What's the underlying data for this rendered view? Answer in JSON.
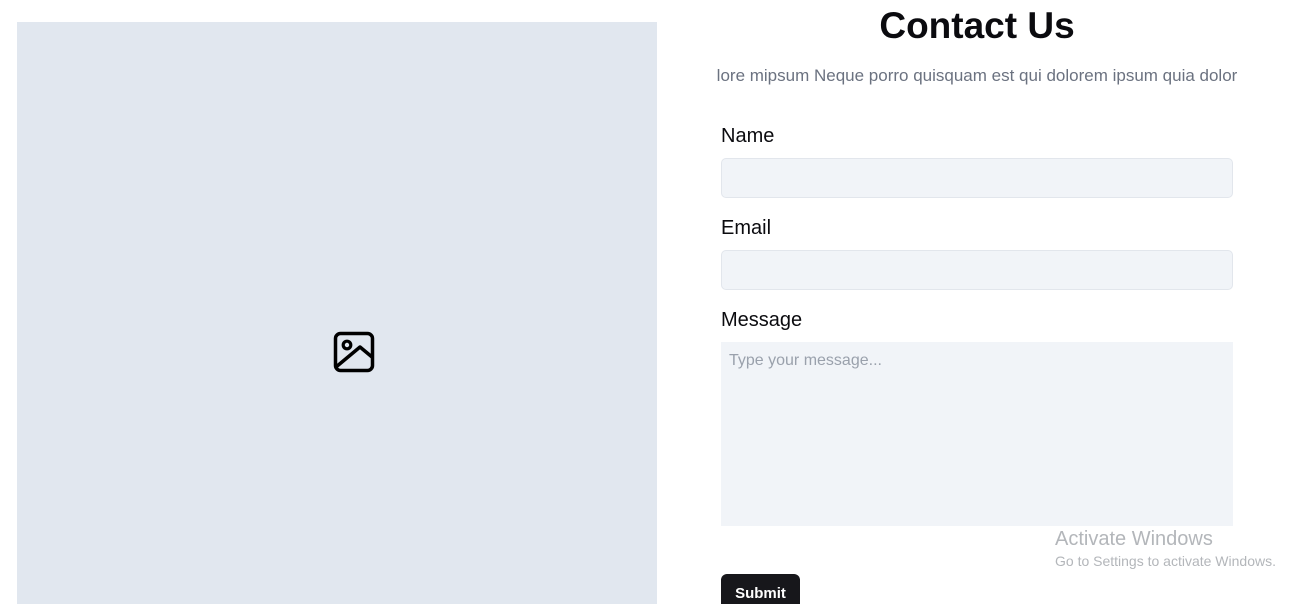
{
  "image_placeholder": {
    "icon": "image-icon",
    "background": "#e1e7ef"
  },
  "header": {
    "title": "Contact Us",
    "subtitle": "lore mipsum Neque porro quisquam est qui dolorem ipsum quia dolor"
  },
  "form": {
    "name_label": "Name",
    "name_value": "",
    "email_label": "Email",
    "email_value": "",
    "message_label": "Message",
    "message_placeholder": "Type your message...",
    "submit_label": "Submit"
  },
  "watermark": {
    "title": "Activate Windows",
    "subtitle": "Go to Settings to activate Windows."
  },
  "colors": {
    "field_bg": "#f1f4f8",
    "button_bg": "#17171b",
    "subtitle_text": "#6b7280"
  }
}
